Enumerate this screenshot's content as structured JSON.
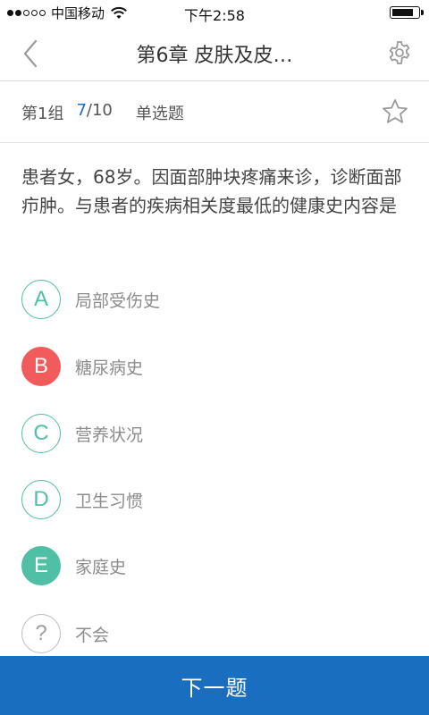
{
  "status_bar": {
    "carrier": "中国移动",
    "time": "下午2:58",
    "battery_level": 0.9
  },
  "nav": {
    "title": "第6章  皮肤及皮…",
    "back_icon": "chevron-left-icon",
    "settings_icon": "gear-icon"
  },
  "sub_bar": {
    "group": "第1组",
    "progress_current": "7",
    "progress_total": "/10",
    "question_type": "单选题",
    "favorite_icon": "star-outline-icon"
  },
  "question": {
    "text": "患者女，68岁。因面部肿块疼痛来诊，诊断面部疖肿。与患者的疾病相关度最低的健康史内容是"
  },
  "options": [
    {
      "letter": "A",
      "text": "局部受伤史",
      "state": "default"
    },
    {
      "letter": "B",
      "text": "糖尿病史",
      "state": "wrong"
    },
    {
      "letter": "C",
      "text": "营养状况",
      "state": "default"
    },
    {
      "letter": "D",
      "text": "卫生习惯",
      "state": "default"
    },
    {
      "letter": "E",
      "text": "家庭史",
      "state": "correct"
    },
    {
      "letter": "?",
      "text": "不会",
      "state": "unknown"
    }
  ],
  "colors": {
    "accent_blue": "#1a6ec0",
    "option_green": "#4fbfa5",
    "wrong_red": "#f25b5b"
  },
  "next_button": {
    "label": "下一题"
  }
}
